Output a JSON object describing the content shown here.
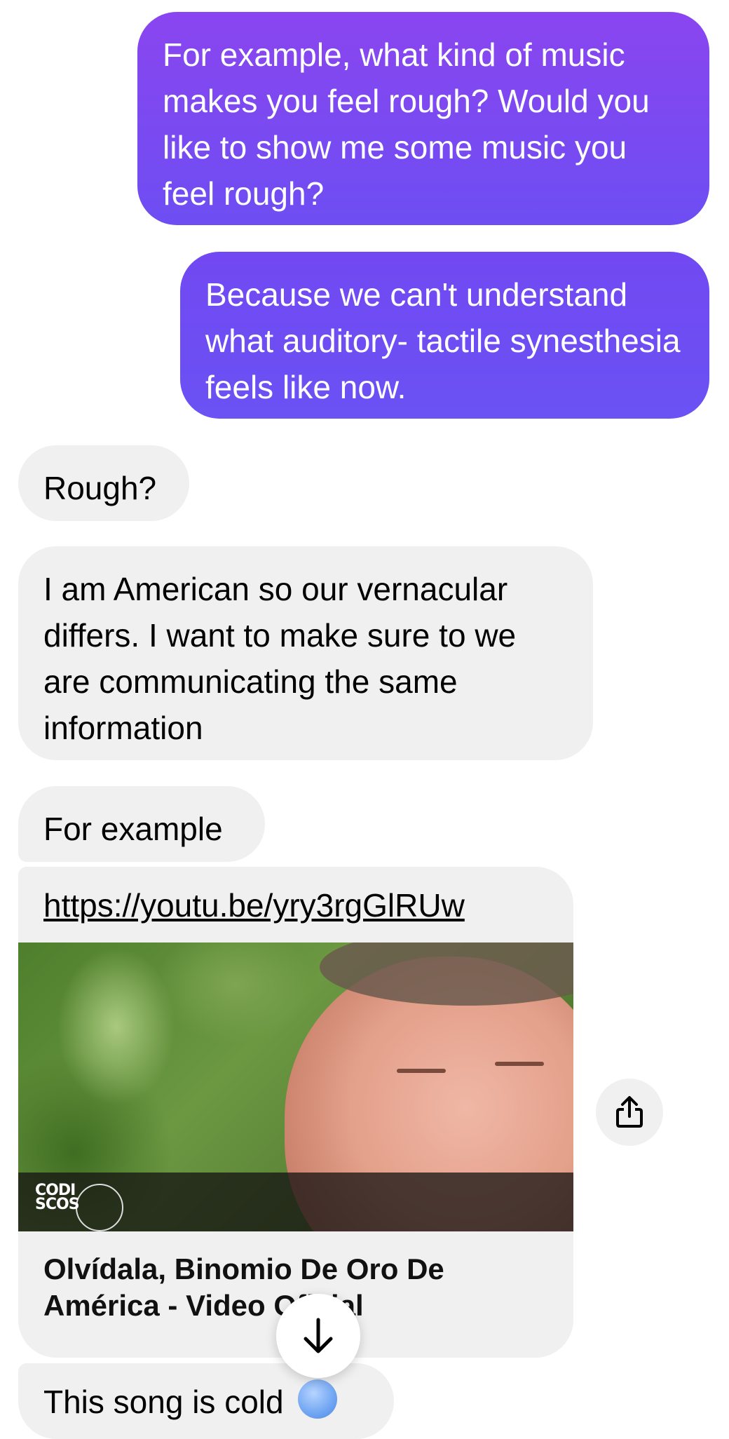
{
  "messages": [
    {
      "id": "m1",
      "direction": "outgoing",
      "text": "For example, what kind of music makes you feel rough? Would you like to show me some music you feel rough?"
    },
    {
      "id": "m2",
      "direction": "outgoing",
      "text": "Because we can't understand what auditory- tactile synesthesia feels like now."
    },
    {
      "id": "m3",
      "direction": "incoming",
      "text": "Rough?"
    },
    {
      "id": "m4",
      "direction": "incoming",
      "text": "I am American so our vernacular differs. I want to make sure to we are communicating the same information"
    },
    {
      "id": "m5",
      "direction": "incoming",
      "text": "For example"
    }
  ],
  "link_preview": {
    "url": "https://youtu.be/yry3rgGlRUw",
    "title": "Olvídala, Binomio De Oro De América - Video Oficial",
    "logo_text": "CODISCOS"
  },
  "last_message": {
    "text": "This song is cold",
    "emoji": "cold-face-emoji"
  },
  "icons": {
    "share": "share-icon",
    "scroll_down": "arrow-down-icon"
  },
  "colors": {
    "outgoing_top": "#8a45f0",
    "outgoing_bottom": "#6d4ef2",
    "incoming_bg": "#f0f0f0"
  }
}
